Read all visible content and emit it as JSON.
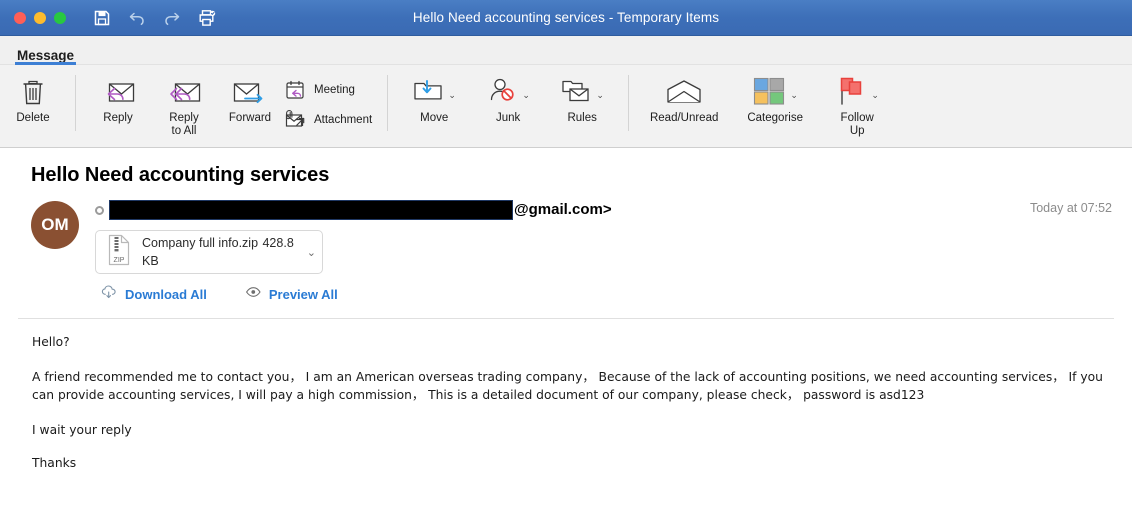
{
  "window": {
    "title": "Hello Need accounting services - Temporary Items",
    "traffic_lights": [
      "close",
      "minimize",
      "maximize"
    ],
    "quick_actions": [
      {
        "name": "save-icon",
        "label": "Save"
      },
      {
        "name": "undo-icon",
        "label": "Undo"
      },
      {
        "name": "redo-icon",
        "label": "Redo"
      },
      {
        "name": "print-icon",
        "label": "Print"
      }
    ]
  },
  "ribbon": {
    "tabs": [
      {
        "label": "Message",
        "active": true
      }
    ],
    "groups": [
      {
        "buttons": [
          {
            "label": "Delete",
            "icon": "trash-icon",
            "caret": false
          }
        ]
      },
      {
        "buttons": [
          {
            "label": "Reply",
            "icon": "reply-icon",
            "caret": false
          },
          {
            "label": "Reply\nto All",
            "label_line1": "Reply",
            "label_line2": "to All",
            "icon": "reply-all-icon",
            "caret": false
          },
          {
            "label": "Forward",
            "icon": "forward-icon",
            "caret": false
          }
        ],
        "stacked": [
          {
            "label": "Meeting",
            "icon": "meeting-icon"
          },
          {
            "label": "Attachment",
            "icon": "attachment-icon"
          }
        ]
      },
      {
        "buttons": [
          {
            "label": "Move",
            "icon": "move-icon",
            "caret": true
          },
          {
            "label": "Junk",
            "icon": "junk-icon",
            "caret": true
          },
          {
            "label": "Rules",
            "icon": "rules-icon",
            "caret": true
          }
        ]
      },
      {
        "buttons": [
          {
            "label": "Read/Unread",
            "icon": "read-unread-icon",
            "caret": false
          },
          {
            "label": "Categorise",
            "icon": "categorise-icon",
            "caret": true
          },
          {
            "label": "Follow\nUp",
            "label_line1": "Follow",
            "label_line2": "Up",
            "icon": "follow-up-flag-icon",
            "caret": true
          }
        ]
      }
    ]
  },
  "message": {
    "subject": "Hello Need accounting services",
    "avatar_initials": "OM",
    "avatar_color": "#8a5032",
    "sender_redacted": true,
    "sender_domain": "@gmail.com>",
    "timestamp": "Today at 07:52",
    "attachments": [
      {
        "filename": "Company full info.zip",
        "size": "428.8 KB",
        "type_label": "ZIP"
      }
    ],
    "attachment_actions": [
      {
        "label": "Download All",
        "icon": "cloud-download-icon"
      },
      {
        "label": "Preview All",
        "icon": "eye-icon"
      }
    ],
    "body_paragraphs": [
      "Hello?",
      "A friend recommended me to contact you， I am an American overseas trading company， Because of the lack of accounting positions, we need accounting services， If you can provide accounting services, I will pay a high commission， This is a detailed document of our company, please check， password is asd123",
      "I wait your reply",
      "Thanks"
    ]
  },
  "colors": {
    "titlebar": "#3d6fb8",
    "tab_underline": "#3d7fd4",
    "link": "#2a7bd4",
    "redaction": "#000000",
    "redaction_border": "#1f3864"
  }
}
